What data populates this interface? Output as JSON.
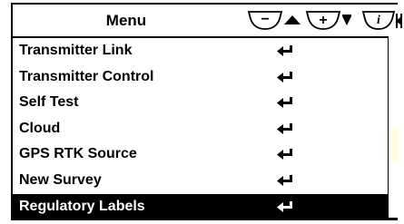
{
  "header": {
    "title": "Menu",
    "softkeys": [
      {
        "name": "minus",
        "symbol": "−",
        "icon": "triangle-up-icon"
      },
      {
        "name": "plus",
        "symbol": "+",
        "icon": "triangle-down-icon"
      },
      {
        "name": "info",
        "symbol": "i",
        "icon": "exit-icon"
      }
    ]
  },
  "menu": {
    "items": [
      {
        "label": "Transmitter Link",
        "icon": "enter-icon",
        "selected": false
      },
      {
        "label": "Transmitter Control",
        "icon": "enter-icon",
        "selected": false
      },
      {
        "label": "Self Test",
        "icon": "enter-icon",
        "selected": false
      },
      {
        "label": "Cloud",
        "icon": "enter-icon",
        "selected": false
      },
      {
        "label": "GPS RTK Source",
        "icon": "enter-icon",
        "selected": false
      },
      {
        "label": "New Survey",
        "icon": "enter-icon",
        "selected": false
      },
      {
        "label": "Regulatory Labels",
        "icon": "enter-icon",
        "selected": true
      }
    ]
  },
  "colors": {
    "foreground": "#000000",
    "background": "#ffffff",
    "selected_bg": "#000000",
    "selected_fg": "#ffffff"
  }
}
